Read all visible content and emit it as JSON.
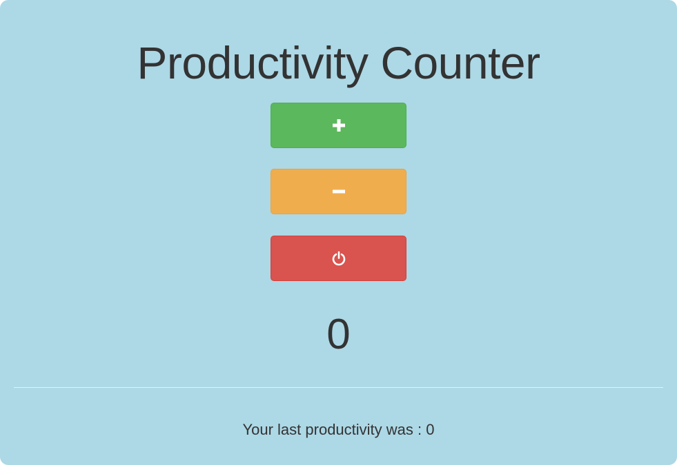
{
  "app": {
    "title": "Productivity Counter"
  },
  "buttons": {
    "increment": {
      "icon": "plus-icon",
      "color": "#5cb85c"
    },
    "decrement": {
      "icon": "minus-icon",
      "color": "#f0ad4e"
    },
    "reset": {
      "icon": "power-icon",
      "color": "#d9534f"
    }
  },
  "counter": {
    "value": "0"
  },
  "footer": {
    "last_label": "Your last productivity was :",
    "last_value": "0"
  }
}
